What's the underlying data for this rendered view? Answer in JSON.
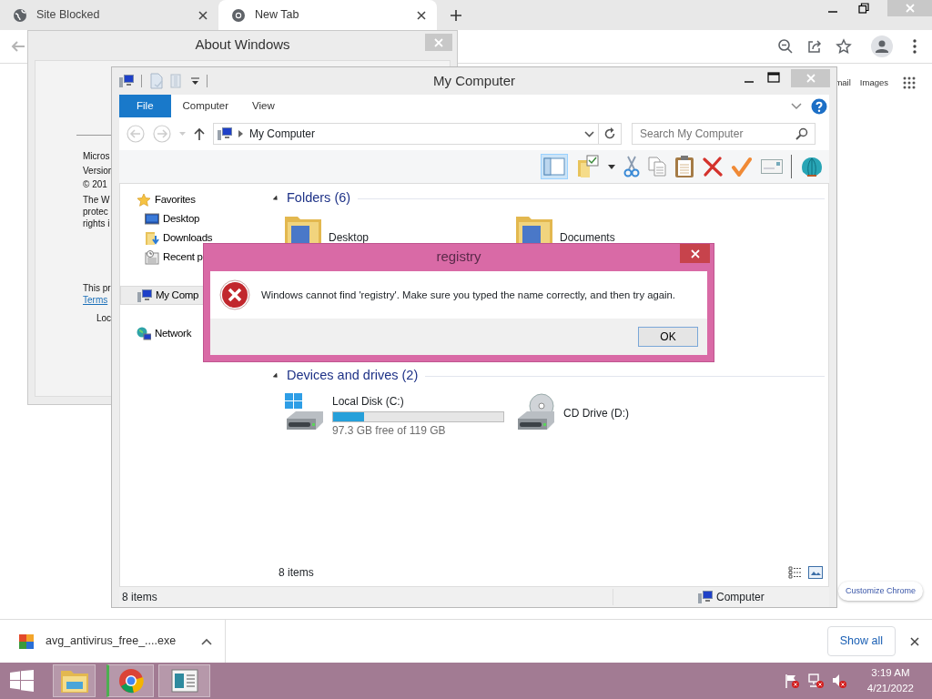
{
  "browser": {
    "tabs": [
      {
        "title": "Site Blocked",
        "kind": "globe",
        "selected": false
      },
      {
        "title": "New Tab",
        "kind": "chrome",
        "selected": true
      }
    ],
    "page_links": [
      "mail",
      "Images"
    ],
    "customize_button": "Customize Chrome"
  },
  "about_window": {
    "title": "About Windows",
    "lines": [
      "Micros",
      "Versior",
      "© 201"
    ],
    "paragraph": [
      "The W",
      "protec",
      "rights i"
    ],
    "notice": "This pr",
    "link": "Terms",
    "footer": "Loc"
  },
  "explorer": {
    "title": "My Computer",
    "ribbon_tabs": [
      {
        "label": "File",
        "selected": true
      },
      {
        "label": "Computer",
        "selected": false
      },
      {
        "label": "View",
        "selected": false
      }
    ],
    "address": "My Computer",
    "search": {
      "placeholder": "Search My Computer"
    },
    "nav": [
      {
        "label": "Favorites",
        "kind": "favorites",
        "selected": false,
        "children": [
          {
            "label": "Desktop",
            "kind": "desktop",
            "selected": false
          },
          {
            "label": "Downloads",
            "kind": "downloads",
            "selected": false
          },
          {
            "label": "Recent p",
            "kind": "recent",
            "selected": false
          }
        ]
      },
      {
        "label": "My Comp",
        "kind": "computer",
        "selected": true
      },
      {
        "label": "Network",
        "kind": "network",
        "selected": false
      }
    ],
    "groups": [
      {
        "title": "Folders (6)",
        "items": [
          {
            "name": "Desktop",
            "kind": "folder"
          },
          {
            "name": "Documents",
            "kind": "folder"
          }
        ]
      },
      {
        "title": "Devices and drives (2)",
        "items": [
          {
            "name": "Local Disk (C:)",
            "kind": "disk",
            "level": 0.18,
            "reading": "97.3 GB free of 119 GB"
          },
          {
            "name": "CD Drive (D:)",
            "kind": "cd"
          }
        ]
      }
    ],
    "item_count": "8 items",
    "status_bar": {
      "count": "8 items",
      "location": "Computer"
    }
  },
  "dialog": {
    "title": "registry",
    "message": "Windows cannot find 'registry'. Make sure you typed the name correctly, and then try again.",
    "button": "OK"
  },
  "downloads": {
    "file": "avg_antivirus_free_....exe",
    "show_all": "Show all"
  },
  "taskbar": {
    "time": "3:19 AM",
    "date": "4/21/2022"
  }
}
